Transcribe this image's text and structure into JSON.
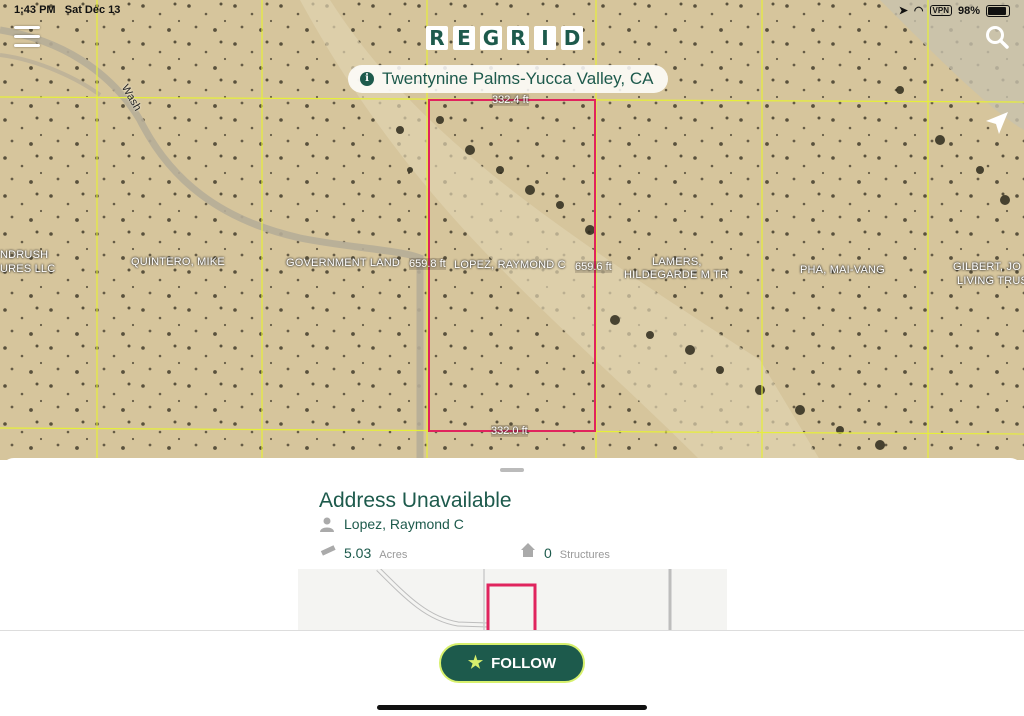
{
  "status_bar": {
    "time": "1:43 PM",
    "date": "Sat Dec 13",
    "vpn": "VPN",
    "battery": "98%"
  },
  "header": {
    "logo_letters": [
      "R",
      "E",
      "G",
      "R",
      "I",
      "D"
    ],
    "region": "Twentynine Palms-Yucca Valley, CA"
  },
  "map": {
    "road_label": "Wash",
    "parcels": {
      "left_edge": [
        "NDRUSH",
        "URES LLC"
      ],
      "quintero": "QUINTERO, MIKE",
      "government": "GOVERNMENT LAND",
      "selected": "LOPEZ, RAYMOND C",
      "lamers": [
        "LAMERS,",
        "HILDEGARDE M TR"
      ],
      "pha": "PHA, MAI-VANG",
      "gilbert": [
        "GILBERT, JO",
        "LIVING TRUS"
      ]
    },
    "dimensions": {
      "top": "332.4 ft",
      "bottom": "332.0 ft",
      "left": "659.8 ft",
      "right": "659.6 ft"
    }
  },
  "details": {
    "address": "Address Unavailable",
    "owner": "Lopez, Raymond C",
    "acres_value": "5.03",
    "acres_unit": "Acres",
    "structures_value": "0",
    "structures_unit": "Structures"
  },
  "actions": {
    "follow_label": "FOLLOW"
  },
  "colors": {
    "brand": "#1d5a4c",
    "accent": "#d7f06d",
    "parcel_selected": "#e0245e",
    "parcel_lines": "#e6ef3a"
  }
}
